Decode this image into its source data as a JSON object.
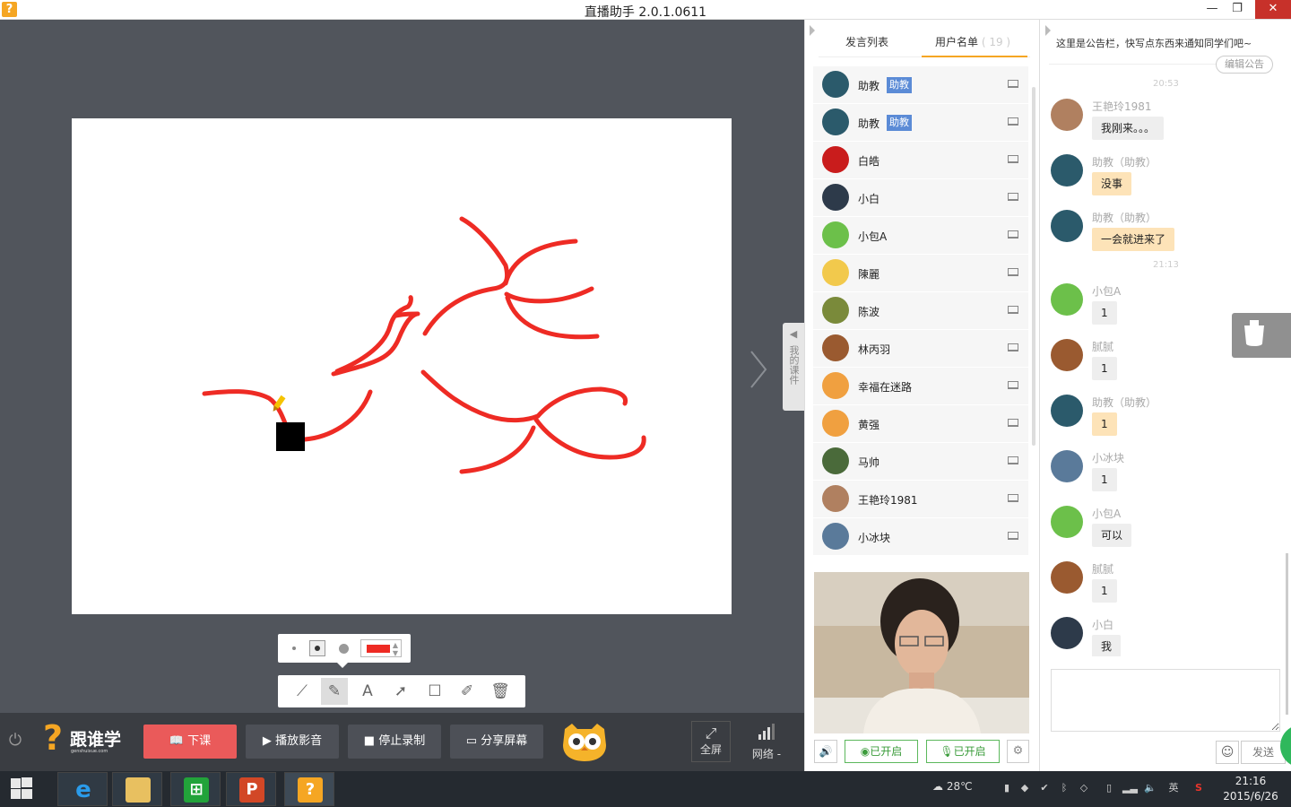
{
  "window": {
    "title": "直播助手 2.0.1.0611",
    "app_icon": "question-logo-icon",
    "minimize": "—",
    "restore": "❐",
    "close": "✕"
  },
  "whiteboard": {
    "background": "#ffffff",
    "stroke_color": "#ee2b24",
    "courseware_tab": "我的课件",
    "pen_color": "#ee2b24",
    "pen_sizes": [
      "small",
      "medium",
      "large"
    ],
    "tools": [
      "line-tool",
      "pencil-tool",
      "text-tool",
      "arrow-tool",
      "rectangle-tool",
      "eraser-tool",
      "delete-tool"
    ],
    "active_tool": "pencil-tool"
  },
  "bottombar": {
    "logo_name": "跟谁学",
    "logo_url": "genshuixue.com",
    "end_class": "下课",
    "play_media": "播放影音",
    "stop_record": "停止录制",
    "share_screen": "分享屏幕",
    "fullscreen": "全屏",
    "network": "网络 -"
  },
  "middle_panel": {
    "tabs": {
      "chat_list": "发言列表",
      "user_list": "用户名单",
      "user_count": "( 19 )"
    },
    "users": [
      {
        "name": "助教",
        "badge": "助教",
        "avatar_color": "#2b5a6b",
        "avatar_icon": "snowflake"
      },
      {
        "name": "助教",
        "badge": "助教",
        "avatar_color": "#2b5a6b",
        "avatar_icon": "snowflake"
      },
      {
        "name": "白皓",
        "badge": "",
        "avatar_color": "#c91c1c",
        "avatar_icon": "flower"
      },
      {
        "name": "小白",
        "badge": "",
        "avatar_color": "#2d3a4a",
        "avatar_icon": "calculator"
      },
      {
        "name": "小包A",
        "badge": "",
        "avatar_color": "#6cc04a",
        "avatar_icon": "graduation-cap"
      },
      {
        "name": "陳麗",
        "badge": "",
        "avatar_color": "#f2c94c",
        "avatar_icon": "guitar"
      },
      {
        "name": "陈波",
        "badge": "",
        "avatar_color": "#7a8a3a",
        "avatar_icon": "photo"
      },
      {
        "name": "林丙羽",
        "badge": "",
        "avatar_color": "#9a5a30",
        "avatar_icon": "photo"
      },
      {
        "name": "幸福在迷路",
        "badge": "",
        "avatar_color": "#f0a040",
        "avatar_icon": "leaf"
      },
      {
        "name": "黄强",
        "badge": "",
        "avatar_color": "#f0a040",
        "avatar_icon": "leaf"
      },
      {
        "name": "马帅",
        "badge": "",
        "avatar_color": "#4a6a3a",
        "avatar_icon": "photo"
      },
      {
        "name": "王艳玲1981",
        "badge": "",
        "avatar_color": "#b08060",
        "avatar_icon": "photo"
      },
      {
        "name": "小冰块",
        "badge": "",
        "avatar_color": "#5a7a9a",
        "avatar_icon": "photo"
      }
    ],
    "video": {
      "audio_btn": "🔊",
      "camera_on": "已开启",
      "mic_on": "已开启",
      "settings": "⚙"
    }
  },
  "chat": {
    "notice": "这里是公告栏，快写点东西来通知同学们吧~",
    "edit_notice": "编辑公告",
    "timestamps": [
      "20:53",
      "21:13"
    ],
    "messages": [
      {
        "sender": "王艳玲1981",
        "text": "我刚来。。。",
        "style": "plain",
        "avatar_color": "#b08060",
        "avatar_icon": "photo"
      },
      {
        "sender": "助教（助教）",
        "text": "没事",
        "style": "orange",
        "avatar_color": "#2b5a6b",
        "avatar_icon": "snowflake"
      },
      {
        "sender": "助教（助教）",
        "text": "一会就进来了",
        "style": "orange",
        "avatar_color": "#2b5a6b",
        "avatar_icon": "snowflake"
      },
      {
        "sender": "小包A",
        "text": "1",
        "style": "plain",
        "avatar_color": "#6cc04a",
        "avatar_icon": "graduation-cap"
      },
      {
        "sender": "腻腻",
        "text": "1",
        "style": "plain",
        "avatar_color": "#9a5a30",
        "avatar_icon": "photo"
      },
      {
        "sender": "助教（助教）",
        "text": "1",
        "style": "orange",
        "avatar_color": "#2b5a6b",
        "avatar_icon": "snowflake"
      },
      {
        "sender": "小冰块",
        "text": "1",
        "style": "plain",
        "avatar_color": "#5a7a9a",
        "avatar_icon": "photo"
      },
      {
        "sender": "小包A",
        "text": "可以",
        "style": "plain",
        "avatar_color": "#6cc04a",
        "avatar_icon": "graduation-cap"
      },
      {
        "sender": "腻腻",
        "text": "1",
        "style": "plain",
        "avatar_color": "#9a5a30",
        "avatar_icon": "photo"
      },
      {
        "sender": "小白",
        "text": "我",
        "style": "plain",
        "avatar_color": "#2d3a4a",
        "avatar_icon": "calculator"
      }
    ],
    "emoji": "☺",
    "send": "发送"
  },
  "taskbar": {
    "apps": [
      "internet-explorer",
      "file-explorer",
      "windows-store",
      "powerpoint",
      "live-assistant"
    ],
    "weather": "28℃",
    "ime": "英",
    "time": "21:16",
    "date": "2015/6/26"
  }
}
